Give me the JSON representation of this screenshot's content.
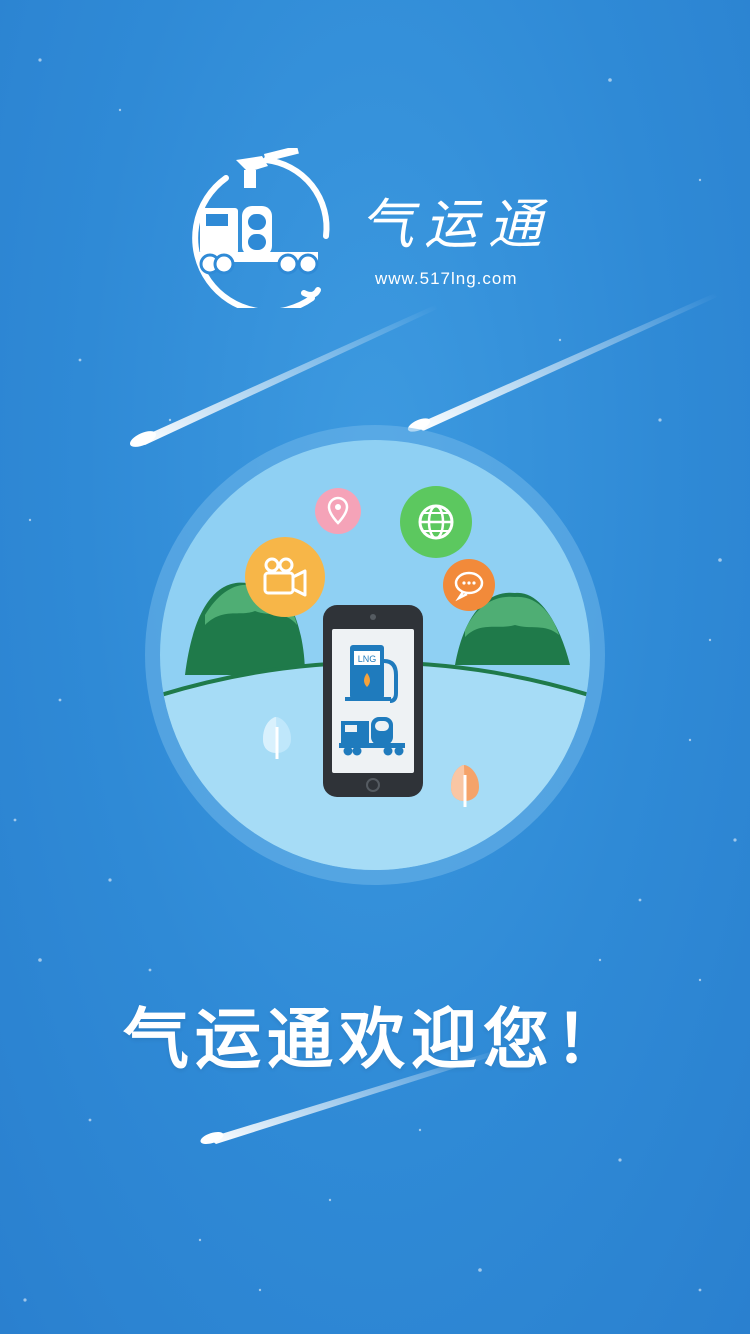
{
  "brand": {
    "name": "气运通",
    "url": "www.517lng.com"
  },
  "illustration": {
    "phone_sign": "LNG",
    "icons": [
      "location-pin-icon",
      "globe-icon",
      "video-camera-icon",
      "chat-bubble-icon"
    ]
  },
  "welcome": {
    "text": "气运通欢迎您！"
  },
  "colors": {
    "background": "#2f8ad6",
    "circle_outer": "#6fb6ea",
    "circle_inner": "#8fd0f3",
    "hill_dark": "#1f7a4a",
    "hill_light": "#4fae74",
    "pin_badge": "#f5a3b8",
    "globe_badge": "#5cc85f",
    "camera_badge": "#f7b648",
    "chat_badge": "#f28a3a",
    "phone_body": "#2f3338",
    "phone_blue": "#1f7bbd",
    "white": "#ffffff"
  }
}
